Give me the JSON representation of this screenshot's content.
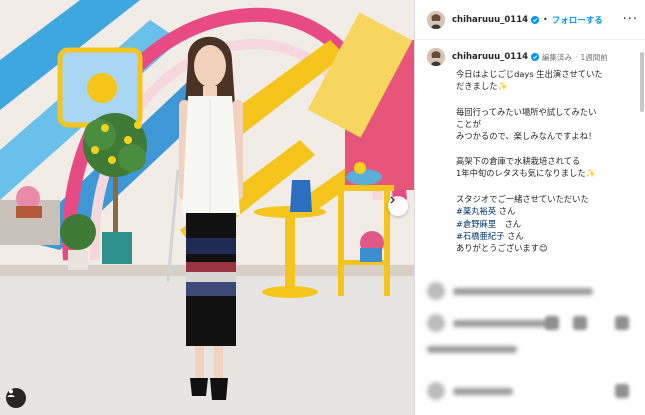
{
  "post": {
    "username": "chiharuuu_0114",
    "follow_label": "フォローする",
    "more_label": "···",
    "edited_label": "編集済み",
    "time_label": "1週間前",
    "caption_lines": [
      "今日はよじごじdays 生出演させていた",
      "だきました",
      "毎回行ってみたい場所や試してみたい",
      "ことが",
      "みつかるので、楽しみなんですよね！",
      "高架下の倉庫で水耕栽培されてる",
      "1年中旬のレタスも気になりました",
      "スタジオでご一緒させていただいた",
      "#薬丸裕英",
      "さん",
      "#倉野麻里",
      "さん",
      "#石橋亜紀子",
      "さん",
      "ありがとうございます"
    ],
    "emoji": {
      "sparkle": "✨",
      "smile": "😊"
    }
  },
  "colors": {
    "accent": "#0095f6",
    "text": "#262626",
    "muted": "#737373",
    "hashtag": "#00376b"
  },
  "icons": {
    "carousel_next": "chevron-right-icon",
    "tagged_people": "person-icon",
    "verified": "verified-badge-icon",
    "more": "more-options-icon"
  }
}
